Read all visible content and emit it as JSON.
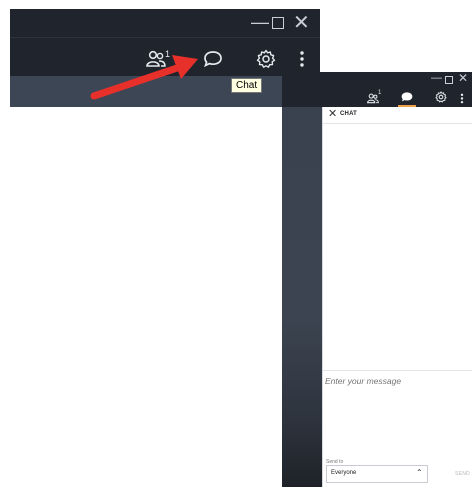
{
  "window_large": {
    "title_controls": {
      "minimize": "—",
      "maximize": "",
      "close": "✕"
    },
    "toolbar": {
      "participants_count": "1",
      "more_glyph": "⋮"
    },
    "tooltip": "Chat"
  },
  "window_small": {
    "title_controls": {
      "minimize": "—",
      "maximize": "",
      "close": "✕"
    },
    "toolbar": {
      "participants_count": "1",
      "more_glyph": "⋮"
    },
    "chat": {
      "close_glyph": "✕",
      "title": "CHAT",
      "message_placeholder": "Enter your message",
      "send_to_label": "Send to",
      "send_to_value": "Everyone",
      "send_label": "SEND"
    }
  },
  "colors": {
    "titlebar": "#20242c",
    "content_dark": "#3c4553",
    "accent_underline": "#f0a04b",
    "arrow": "#e8302b",
    "tooltip_bg": "#ffffe1"
  },
  "icons": [
    "participants-icon",
    "chat-bubble-icon",
    "gear-icon",
    "more-vertical-icon",
    "red-arrow-annotation"
  ]
}
